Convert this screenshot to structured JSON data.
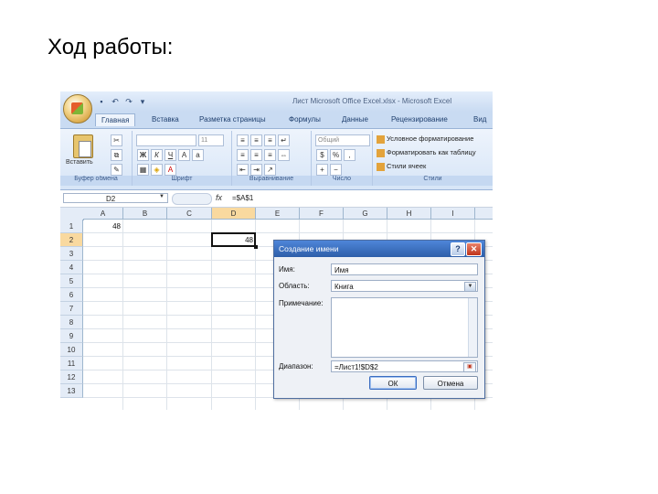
{
  "slide": {
    "title": "Ход работы:"
  },
  "window": {
    "title": "Лист Microsoft Office Excel.xlsx - Microsoft Excel",
    "tabs": [
      "Главная",
      "Вставка",
      "Разметка страницы",
      "Формулы",
      "Данные",
      "Рецензирование",
      "Вид"
    ],
    "active_tab": "Главная"
  },
  "ribbon": {
    "paste_label": "Вставить",
    "font_name": "",
    "font_size": "11",
    "number_format": "Общий",
    "styles": [
      "Условное форматирование",
      "Форматировать как таблицу",
      "Стили ячеек"
    ],
    "group_labels": [
      "Буфер обмена",
      "Шрифт",
      "Выравнивание",
      "Число",
      "Стили"
    ]
  },
  "formula_bar": {
    "name_box": "D2",
    "fx": "fx",
    "formula": "=$A$1"
  },
  "sheet": {
    "columns": [
      "A",
      "B",
      "C",
      "D",
      "E",
      "F",
      "G",
      "H",
      "I"
    ],
    "selected_column": "D",
    "rows": [
      "1",
      "2",
      "3",
      "4",
      "5",
      "6",
      "7",
      "8",
      "9",
      "10",
      "11",
      "12",
      "13"
    ],
    "selected_row": "2",
    "cells": {
      "A1": "48",
      "D2": "48"
    }
  },
  "dialog": {
    "title": "Создание имени",
    "name_label": "Имя:",
    "name_value": "Имя",
    "scope_label": "Область:",
    "scope_value": "Книга",
    "comment_label": "Примечание:",
    "range_label": "Диапазон:",
    "range_value": "=Лист1!$D$2",
    "ok_label": "ОК",
    "cancel_label": "Отмена",
    "help_icon": "?",
    "close_icon": "✕"
  }
}
